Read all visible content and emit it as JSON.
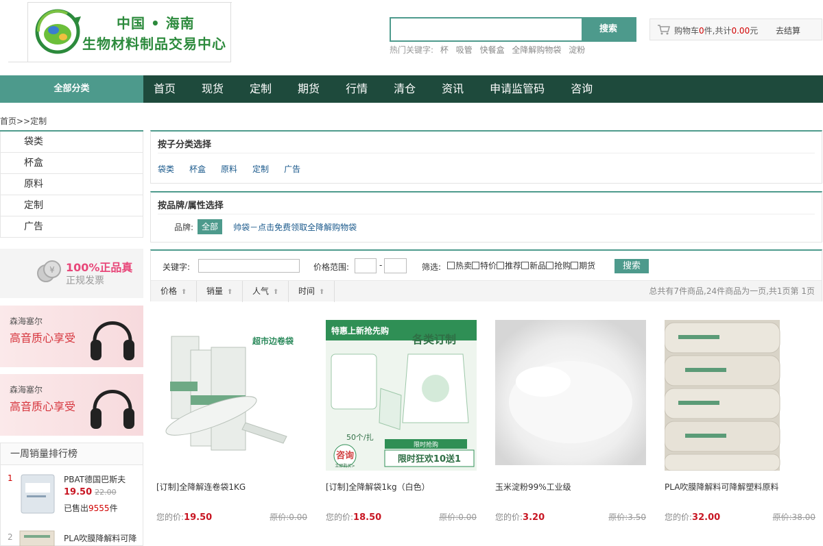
{
  "logo": {
    "line1": "中国 • 海南",
    "line2": "生物材料制品交易中心"
  },
  "search": {
    "value": "",
    "button": "搜索",
    "hot_label": "热门关键字:",
    "hot_words": [
      "杯",
      "吸管",
      "快餐盒",
      "全降解购物袋",
      "淀粉"
    ]
  },
  "cart": {
    "prefix": "购物车",
    "count": "0",
    "mid": "件,共计",
    "amount": "0.00",
    "suffix": "元",
    "checkout": "去结算"
  },
  "nav": {
    "all": "全部分类",
    "items": [
      "首页",
      "现货",
      "定制",
      "期货",
      "行情",
      "清仓",
      "资讯",
      "申请监管码",
      "咨询"
    ]
  },
  "breadcrumb": "首页>>定制",
  "sidebar": {
    "categories": [
      "袋类",
      "杯盒",
      "原料",
      "定制",
      "广告"
    ],
    "promo1": {
      "title": "100%正品真",
      "sub": "正规发票"
    },
    "promo2": {
      "brand": "森海塞尔",
      "slogan": "高音质心享受"
    },
    "promo3": {
      "brand": "森海塞尔",
      "slogan": "高音质心享受"
    },
    "ranking": {
      "title": "一周销量排行榜",
      "items": [
        {
          "num": "1",
          "name": "PBAT德国巴斯夫",
          "price": "19.50",
          "old": "22.00",
          "sold_prefix": "已售出",
          "sold": "9555",
          "sold_suffix": "件"
        },
        {
          "num": "2",
          "name": "PLA吹膜降解料可降"
        }
      ]
    }
  },
  "subcat_panel": {
    "title": "按子分类选择",
    "items": [
      "袋类",
      "杯盒",
      "原料",
      "定制",
      "广告"
    ]
  },
  "brand_panel": {
    "title": "按品牌/属性选择",
    "label": "品牌:",
    "all": "全部",
    "brand": "帅袋－点击免费领取全降解购物袋"
  },
  "filter": {
    "keyword_label": "关键字:",
    "price_label": "价格范围:",
    "dash": "-",
    "filter_label": "筛选:",
    "checks": [
      "热卖",
      "特价",
      "推荐",
      "新品",
      "抢购",
      "期货"
    ],
    "button": "搜索",
    "sorts": [
      "价格",
      "销量",
      "人气",
      "时间"
    ],
    "total": "总共有7件商品,24件商品为一页,共1页第 1页"
  },
  "products": [
    {
      "name": "[订制]全降解连卷袋1KG",
      "price_label": "您的价:",
      "price": "19.50",
      "old": "原价:0.00"
    },
    {
      "name": "[订制]全降解袋1kg（白色）",
      "price_label": "您的价:",
      "price": "18.50",
      "old": "原价:0.00"
    },
    {
      "name": "玉米淀粉99%工业级",
      "price_label": "您的价:",
      "price": "3.20",
      "old": "原价:3.50"
    },
    {
      "name": "PLA吹膜降解料可降解塑料原料",
      "price_label": "您的价:",
      "price": "32.00",
      "old": "原价:38.00"
    }
  ],
  "product_images": {
    "p1": {
      "caption": "超市边卷袋"
    },
    "p2": {
      "banner": "特惠上新抢先购",
      "title": "各类订制",
      "qty": "50个/扎",
      "consult": "咨询",
      "buy": "立即购买>",
      "limited": "限时抢购",
      "deal": "限时狂欢10送1"
    }
  },
  "colors": {
    "accent": "#4d9a8c",
    "nav_bg": "#1e4a3c",
    "price_red": "#c81623",
    "logo_green": "#2c8a3c"
  }
}
